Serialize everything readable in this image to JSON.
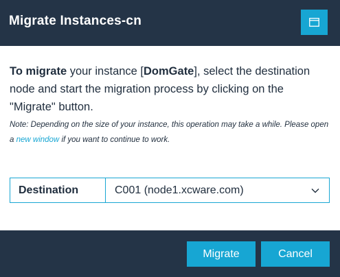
{
  "dialog": {
    "title": "Migrate Instances-cn",
    "window_icon": "window-icon"
  },
  "message": {
    "lead_bold": "To migrate",
    "part1": " your instance [",
    "instance_name": "DomGate",
    "part2": "], select the destination node and start the migration process by clicking on the \"Migrate\" button."
  },
  "note": {
    "before_link": "Note: Depending on the size of your instance, this operation may take a while. Please open a ",
    "link_text": "new window",
    "after_link": " if you want to continue to work."
  },
  "destination": {
    "label": "Destination",
    "selected_value": "C001 (node1.xcware.com)",
    "icon": "chevron-down-icon"
  },
  "footer": {
    "migrate_label": "Migrate",
    "cancel_label": "Cancel"
  },
  "colors": {
    "header_bg": "#243447",
    "accent": "#17a6d3",
    "text": "#1f2d3d"
  }
}
